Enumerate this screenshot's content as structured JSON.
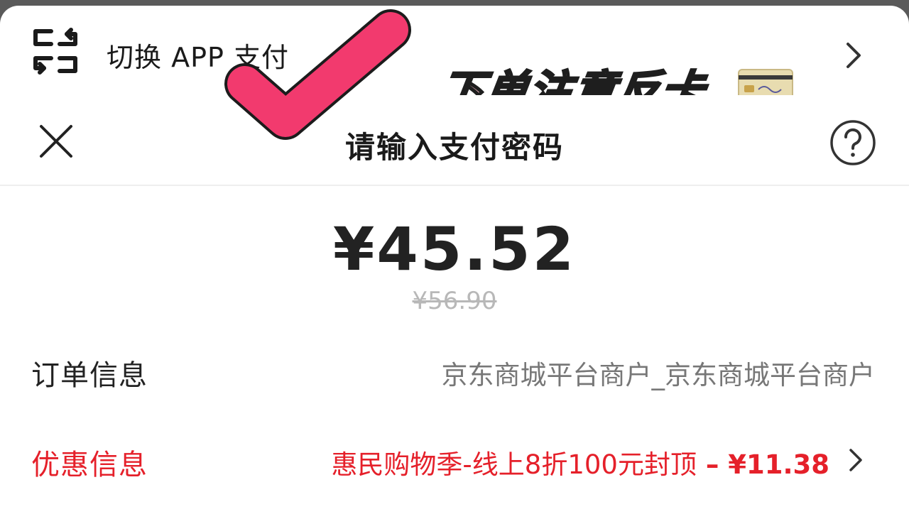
{
  "switch_app": {
    "label": "切换 APP 支付",
    "icon": "switch-icon"
  },
  "sticker": {
    "text": "下单注意反卡",
    "fill_color": "#f7b9c6"
  },
  "sheet": {
    "title": "请输入支付密码",
    "amount": "¥45.52",
    "original_price": "¥56.90"
  },
  "order_info": {
    "label": "订单信息",
    "value": "京东商城平台商户_京东商城平台商户"
  },
  "promo_info": {
    "label": "优惠信息",
    "value": "惠民购物季-线上8折100元封顶",
    "separator": " – ",
    "discount": "¥11.38"
  },
  "colors": {
    "accent_red": "#e5202a",
    "checkmark_pink": "#f23a6e"
  }
}
